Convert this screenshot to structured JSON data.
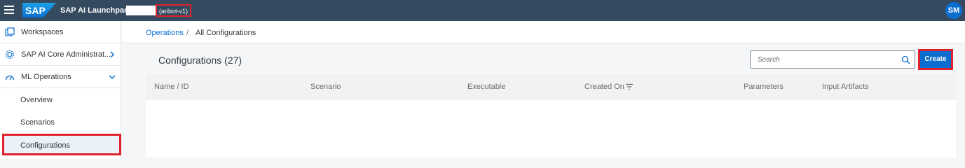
{
  "shell": {
    "title": "SAP AI Launchpad",
    "logo_text": "SAP",
    "tenant": "(aribot-v1)",
    "avatar_initials": "SM"
  },
  "sidebar": {
    "items": [
      {
        "label": "Workspaces",
        "icon": "workspaces-icon"
      },
      {
        "label": "SAP AI Core Administrat...",
        "icon": "admin-gear-icon"
      },
      {
        "label": "ML Operations",
        "icon": "ml-operations-icon"
      },
      {
        "label": "Overview"
      },
      {
        "label": "Scenarios"
      },
      {
        "label": "Configurations"
      }
    ],
    "selected": "Configurations"
  },
  "breadcrumb": {
    "link": "Operations",
    "separator": "/",
    "current": "All Configurations"
  },
  "panel": {
    "title": "Configurations (27)",
    "search_placeholder": "Search",
    "create_label": "Create"
  },
  "table": {
    "columns": [
      "Name / ID",
      "Scenario",
      "Executable",
      "Created On",
      "Parameters",
      "Input Artifacts"
    ]
  },
  "colors": {
    "shell": "#354a5f",
    "accent": "#0a6ed1",
    "highlight": "#e0222f"
  }
}
